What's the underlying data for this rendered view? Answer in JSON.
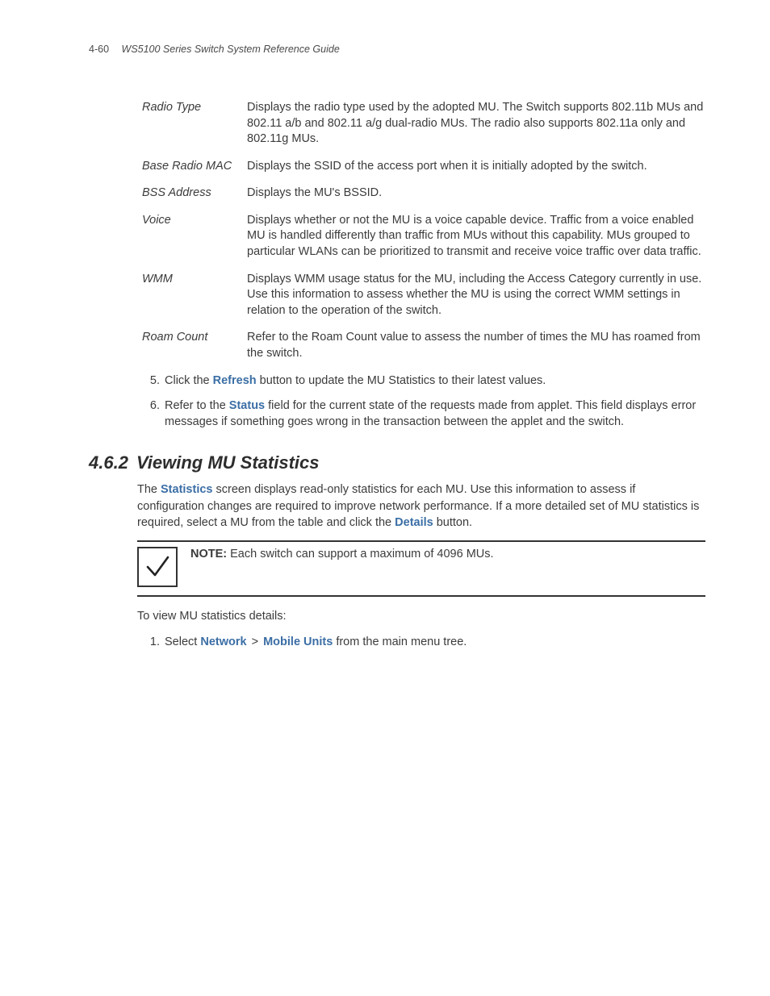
{
  "header": {
    "page_number": "4-60",
    "title": "WS5100 Series Switch System Reference Guide"
  },
  "definitions": [
    {
      "term": "Radio Type",
      "desc": "Displays the radio type used by the adopted MU. The Switch supports 802.11b MUs and 802.11 a/b and 802.11 a/g dual-radio MUs. The radio also supports 802.11a only and 802.11g MUs."
    },
    {
      "term": "Base Radio MAC",
      "desc": "Displays the SSID of the access port when it is initially adopted by the switch."
    },
    {
      "term": "BSS Address",
      "desc": "Displays the MU's BSSID."
    },
    {
      "term": "Voice",
      "desc": "Displays whether or not the MU is a voice capable device. Traffic from a voice enabled MU is handled differently than traffic from MUs without this capability. MUs grouped to particular WLANs can be prioritized to transmit and receive voice traffic over data traffic."
    },
    {
      "term": "WMM",
      "desc": "Displays WMM usage status for the MU, including the Access Category currently in use. Use this information to assess whether the MU is using the correct WMM settings in relation to the operation of the switch."
    },
    {
      "term": "Roam Count",
      "desc": "Refer to the Roam Count value to assess the number of times the MU has roamed from the switch."
    }
  ],
  "steps_a": [
    {
      "num": "5.",
      "pre": "Click the ",
      "bold": "Refresh",
      "post": " button to update the MU Statistics to their latest values."
    },
    {
      "num": "6.",
      "pre": "Refer to the ",
      "bold": "Status",
      "post": " field for the current state of the requests made from applet. This field displays error messages if something goes wrong in the transaction between the applet and the switch."
    }
  ],
  "section": {
    "number": "4.6.2",
    "title": "Viewing MU Statistics"
  },
  "intro": {
    "pre": "The ",
    "b1": "Statistics",
    "mid": " screen displays read-only statistics for each MU. Use this information to assess if configuration changes are required to improve network performance. If a more detailed set of MU statistics is required, select a MU from the table and click the ",
    "b2": "Details",
    "post": " button."
  },
  "note": {
    "label": "NOTE:",
    "text": " Each switch can support a maximum of 4096 MUs."
  },
  "after_note": "To view MU statistics details:",
  "steps_b": [
    {
      "num": "1.",
      "pre": "Select ",
      "b1": "Network",
      "sep": " > ",
      "b2": "Mobile Units",
      "post": " from the main menu tree."
    }
  ]
}
